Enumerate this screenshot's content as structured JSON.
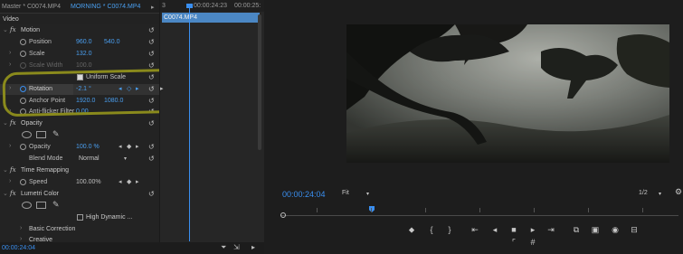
{
  "effect_controls": {
    "tabs": {
      "master": "Master * C0074.MP4",
      "clip": "MORNING * C0074.MP4",
      "more": "▸"
    },
    "header_label": "Video",
    "motion": {
      "label": "Motion",
      "position": {
        "label": "Position",
        "x": "960.0",
        "y": "540.0"
      },
      "scale": {
        "label": "Scale",
        "value": "132.0"
      },
      "scale_width": {
        "label": "Scale Width",
        "value": "100.0"
      },
      "uniform_scale": {
        "label": "Uniform Scale",
        "checked": true
      },
      "rotation": {
        "label": "Rotation",
        "value": "-2.1 °"
      },
      "anchor_point": {
        "label": "Anchor Point",
        "x": "1920.0",
        "y": "1080.0"
      },
      "anti_flicker": {
        "label": "Anti-flicker Filter",
        "value": "0.00"
      }
    },
    "opacity": {
      "label": "Opacity",
      "opacity": {
        "label": "Opacity",
        "value": "100.0 %"
      },
      "blend_mode": {
        "label": "Blend Mode",
        "value": "Normal"
      }
    },
    "time_remapping": {
      "label": "Time Remapping",
      "speed": {
        "label": "Speed",
        "value": "100.00%"
      }
    },
    "lumetri": {
      "label": "Lumetri Color",
      "high_dynamic": "High Dynamic ...",
      "basic_correction": "Basic Correction",
      "creative": "Creative"
    },
    "footer_timecode": "00:00:24:04",
    "mini_timeline": {
      "ruler_start": "3",
      "ruler_mid": "00:00:24:23",
      "ruler_end": "00:00:25:",
      "clip_name": "C0074.MP4"
    }
  },
  "program_monitor": {
    "timecode": "00:00:24:04",
    "zoom": "Fit",
    "resolution": "1/2",
    "video_description_icon": "video-frame",
    "controls": [
      "marker",
      "mark-in",
      "mark-out",
      "go-to-in",
      "step-back",
      "stop",
      "step-forward",
      "go-to-out",
      "insert",
      "overwrite",
      "export-frame",
      "compare"
    ]
  },
  "colors": {
    "accent": "#3a8ff0",
    "clip": "#4b87c4",
    "highlight": "#8a8a1c"
  }
}
